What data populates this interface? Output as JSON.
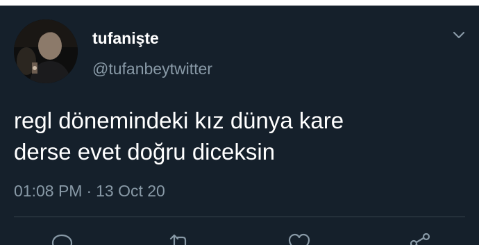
{
  "tweet": {
    "author": {
      "display_name": "tufanişte",
      "handle": "@tufanbeytwitter",
      "avatar_icon": "profile-photo"
    },
    "text_lines": [
      "regl dönemindeki kız dünya kare",
      "derse evet doğru diceksin"
    ],
    "time": "01:08 PM",
    "separator": "·",
    "date": "13 Oct 20",
    "menu_icon": "chevron-down-icon",
    "actions": [
      "reply-icon",
      "retweet-icon",
      "like-icon",
      "share-icon"
    ]
  },
  "colors": {
    "background": "#15202b",
    "primary_text": "#ffffff",
    "secondary_text": "#8899a6",
    "divider": "#38444d"
  }
}
